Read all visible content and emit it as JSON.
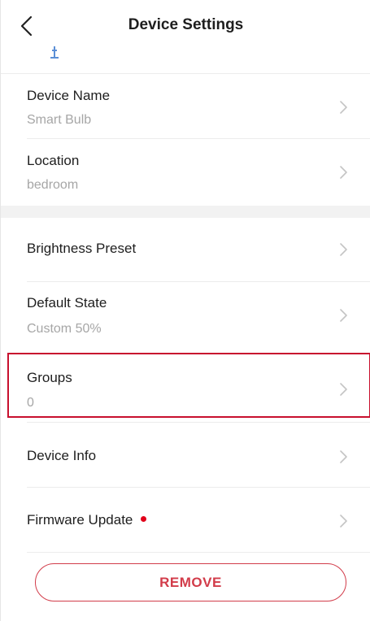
{
  "header": {
    "title": "Device Settings",
    "back_icon": "chevron-left-icon",
    "status_icon": "plug-icon"
  },
  "rows": [
    {
      "title": "Device Name",
      "value": "Smart Bulb"
    },
    {
      "title": "Location",
      "value": "bedroom"
    },
    {
      "title": "Brightness Preset",
      "value": ""
    },
    {
      "title": "Default State",
      "value": "Custom 50%"
    },
    {
      "title": "Groups",
      "value": "0"
    },
    {
      "title": "Device Info",
      "value": ""
    },
    {
      "title": "Firmware Update",
      "value": "",
      "badge": "red-dot"
    }
  ],
  "actions": {
    "remove_label": "REMOVE"
  },
  "colors": {
    "accent_red": "#c8102e",
    "remove_red": "#d23c4a",
    "badge_red": "#e1001a",
    "value_gray": "#a6a6a6",
    "section_gap": "#f2f2f2"
  }
}
